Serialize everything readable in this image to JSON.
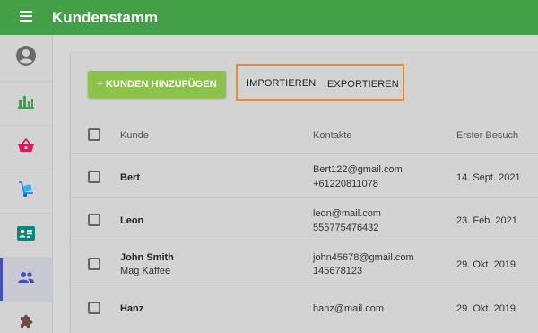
{
  "app": {
    "title": "Kundenstamm",
    "accent_color": "#43a047",
    "menu_icon": "menu-icon"
  },
  "sidebar": {
    "items": [
      {
        "icon": "account-circle-icon",
        "active": false
      },
      {
        "icon": "bar-chart-icon",
        "active": false
      },
      {
        "icon": "shopping-basket-icon",
        "active": false
      },
      {
        "icon": "hand-truck-icon",
        "active": false
      },
      {
        "icon": "contact-card-icon",
        "active": false
      },
      {
        "icon": "people-icon",
        "active": true
      },
      {
        "icon": "puzzle-icon",
        "active": false
      }
    ]
  },
  "toolbar": {
    "add_label": "+ KUNDEN HINZUFÜGEN",
    "import_label": "IMPORTIEREN",
    "export_label": "EXPORTIEREN",
    "highlight_color": "#f08a30"
  },
  "table": {
    "headers": {
      "customer": "Kunde",
      "contacts": "Kontakte",
      "first_visit": "Erster Besuch"
    },
    "rows": [
      {
        "name": "Bert",
        "company": "",
        "email": "Bert122@gmail.com",
        "phone": "+61220811078",
        "date": "14. Sept. 2021"
      },
      {
        "name": "Leon",
        "company": "",
        "email": "leon@mail.com",
        "phone": "555775476432",
        "date": "23. Feb. 2021"
      },
      {
        "name": "John Smith",
        "company": "Mag Kaffee",
        "email": "john45678@gmail.com",
        "phone": "145678123",
        "date": "29. Okt. 2019"
      },
      {
        "name": "Hanz",
        "company": "",
        "email": "hanz@mail.com",
        "phone": "",
        "date": "29. Okt. 2019"
      }
    ]
  }
}
